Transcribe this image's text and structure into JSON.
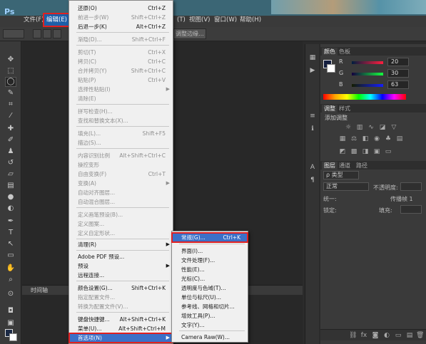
{
  "app": {
    "logo": "Ps"
  },
  "menubar": {
    "items": [
      {
        "label": "文件(F)"
      },
      {
        "label": "编辑(E)"
      },
      {
        "label": "(T)"
      },
      {
        "label": "视图(V)"
      },
      {
        "label": "窗口(W)"
      },
      {
        "label": "帮助(H)"
      }
    ]
  },
  "options": {
    "refine_label": "调整边缘..."
  },
  "edit_menu": {
    "items": [
      {
        "label": "还原(O)",
        "shortcut": "Ctrl+Z"
      },
      {
        "label": "前进一步(W)",
        "shortcut": "Shift+Ctrl+Z"
      },
      {
        "label": "后退一步(K)",
        "shortcut": "Alt+Ctrl+Z"
      },
      {
        "label": "渐隐(D)...",
        "shortcut": "Shift+Ctrl+F"
      },
      {
        "label": "剪切(T)",
        "shortcut": "Ctrl+X"
      },
      {
        "label": "拷贝(C)",
        "shortcut": "Ctrl+C"
      },
      {
        "label": "合并拷贝(Y)",
        "shortcut": "Shift+Ctrl+C"
      },
      {
        "label": "粘贴(P)",
        "shortcut": "Ctrl+V"
      },
      {
        "label": "选择性粘贴(I)",
        "shortcut": ""
      },
      {
        "label": "清除(E)",
        "shortcut": ""
      },
      {
        "label": "拼写检查(H)...",
        "shortcut": ""
      },
      {
        "label": "查找和替换文本(X)...",
        "shortcut": ""
      },
      {
        "label": "填充(L)...",
        "shortcut": "Shift+F5"
      },
      {
        "label": "描边(S)...",
        "shortcut": ""
      },
      {
        "label": "内容识别比例",
        "shortcut": "Alt+Shift+Ctrl+C"
      },
      {
        "label": "操控变形",
        "shortcut": ""
      },
      {
        "label": "自由变换(F)",
        "shortcut": "Ctrl+T"
      },
      {
        "label": "变换(A)",
        "shortcut": ""
      },
      {
        "label": "自动对齐图层...",
        "shortcut": ""
      },
      {
        "label": "自动混合图层...",
        "shortcut": ""
      },
      {
        "label": "定义画笔预设(B)...",
        "shortcut": ""
      },
      {
        "label": "定义图案...",
        "shortcut": ""
      },
      {
        "label": "定义自定形状...",
        "shortcut": ""
      },
      {
        "label": "清理(R)",
        "shortcut": ""
      },
      {
        "label": "Adobe PDF 预设...",
        "shortcut": ""
      },
      {
        "label": "预设",
        "shortcut": ""
      },
      {
        "label": "远程连接...",
        "shortcut": ""
      },
      {
        "label": "颜色设置(G)...",
        "shortcut": "Shift+Ctrl+K"
      },
      {
        "label": "指定配置文件...",
        "shortcut": ""
      },
      {
        "label": "转换为配置文件(V)...",
        "shortcut": ""
      },
      {
        "label": "键盘快捷键...",
        "shortcut": "Alt+Shift+Ctrl+K"
      },
      {
        "label": "菜单(U)...",
        "shortcut": "Alt+Shift+Ctrl+M"
      },
      {
        "label": "首选项(N)",
        "shortcut": ""
      }
    ]
  },
  "pref_menu": {
    "items": [
      {
        "label": "常规(G)...",
        "shortcut": "Ctrl+K"
      },
      {
        "label": "界面(I)...",
        "shortcut": ""
      },
      {
        "label": "文件处理(F)...",
        "shortcut": ""
      },
      {
        "label": "性能(E)...",
        "shortcut": ""
      },
      {
        "label": "光标(C)...",
        "shortcut": ""
      },
      {
        "label": "透明度与色域(T)...",
        "shortcut": ""
      },
      {
        "label": "单位与标尺(U)...",
        "shortcut": ""
      },
      {
        "label": "参考线、网格和切片...",
        "shortcut": ""
      },
      {
        "label": "增效工具(P)...",
        "shortcut": ""
      },
      {
        "label": "文字(Y)...",
        "shortcut": ""
      },
      {
        "label": "Camera Raw(W)...",
        "shortcut": ""
      }
    ]
  },
  "color_panel": {
    "tabs": [
      "颜色",
      "色板"
    ],
    "r_label": "R",
    "r_value": "20",
    "g_label": "G",
    "g_value": "30",
    "b_label": "B",
    "b_value": "63",
    "fg_color": "#141e3f"
  },
  "adjust_panel": {
    "tabs": [
      "调整",
      "样式"
    ],
    "title": "添加调整"
  },
  "layers_panel": {
    "tabs": [
      "图层",
      "通道",
      "路径"
    ],
    "kind": "ρ 类型",
    "blend_mode": "正常",
    "opacity_label": "不透明度:",
    "lock_label": "锁定:",
    "fill_label": "填充:",
    "unify_label": "统一:",
    "propagate_label": "传播帧 1"
  },
  "timeline": {
    "label": "时间轴"
  }
}
